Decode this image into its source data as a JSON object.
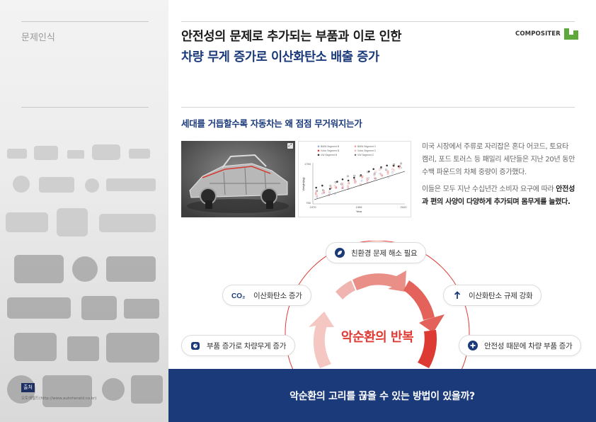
{
  "sidebar": {
    "section_label": "문제인식",
    "source_badge": "출처",
    "source_text": "오토헤럴드(http://www.autoherald.co.kr)"
  },
  "header": {
    "title_line1": "안전성의 문제로 추가되는 부품과 이로 인한",
    "title_line2": "차량 무게 증가로 이산화탄소 배출 증가",
    "logo_text": "COMPOSITER"
  },
  "content": {
    "subheading": "세대를 거듭할수록 자동차는 왜 점점 무거워지는가",
    "paragraph1": "미국 시장에서 주류로 자리잡은 혼다 어코드, 토요타 캠리, 포드 토러스 등 패밀리 세단들은 지난 20년 동안 수백 파운드의 차체 중량이 증가했다.",
    "paragraph2_prefix": "이들은 모두 지난 수십년간 소비자 요구에 따라 ",
    "paragraph2_strong": "안전성과 편의 사양이 다양하게 추가되며 몸무게를 늘렸다."
  },
  "mini_chart": {
    "legend": [
      "BMW Segment B",
      "BMW Segment C",
      "Volvo Segment B",
      "Volvo Segment C",
      "VW Segment B",
      "VW Segment C"
    ],
    "y_ticks": [
      "1750",
      "750"
    ],
    "x_ticks": [
      "1970",
      "1995",
      "2020"
    ],
    "ylabel": "Weight(kg)",
    "xlabel": "Year"
  },
  "cycle": {
    "title": "악순환의 반복",
    "items": {
      "eco": "친환경 문제 해소 필요",
      "co2": "이산화탄소 증가",
      "regulation": "이산화탄소 규제 강화",
      "parts": "부품 증가로 차량무게 증가",
      "safety": "안전성 때문에 차량 부품 증가"
    },
    "co2_icon_text": "CO₂"
  },
  "banner": {
    "text": "악순환의 고리를 끊을 수 있는 방법이 있을까?"
  },
  "colors": {
    "navy": "#1b3a7a",
    "accent_red": "#e03a34",
    "logo_green": "#5fa83b"
  }
}
